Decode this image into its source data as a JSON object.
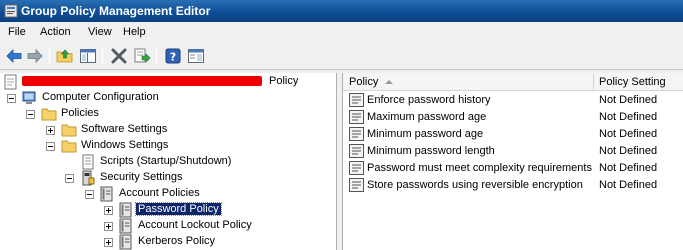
{
  "window": {
    "title": "Group Policy Management Editor"
  },
  "menu": [
    "File",
    "Action",
    "View",
    "Help"
  ],
  "toolbar": [
    "back-icon",
    "forward-icon",
    "up-folder-icon",
    "show-hide-tree-icon",
    "delete-icon",
    "export-list-icon",
    "help-icon",
    "properties-icon"
  ],
  "tree": {
    "root_suffix": "Policy",
    "computer_configuration": "Computer Configuration",
    "policies": "Policies",
    "software_settings": "Software Settings",
    "windows_settings": "Windows Settings",
    "scripts": "Scripts (Startup/Shutdown)",
    "security_settings": "Security Settings",
    "account_policies": "Account Policies",
    "password_policy": "Password Policy",
    "account_lockout_policy": "Account Lockout Policy",
    "kerberos_policy": "Kerberos Policy"
  },
  "list": {
    "col_policy": "Policy",
    "col_setting": "Policy Setting",
    "rows": [
      {
        "policy": "Enforce password history",
        "setting": "Not Defined"
      },
      {
        "policy": "Maximum password age",
        "setting": "Not Defined"
      },
      {
        "policy": "Minimum password age",
        "setting": "Not Defined"
      },
      {
        "policy": "Minimum password length",
        "setting": "Not Defined"
      },
      {
        "policy": "Password must meet complexity requirements",
        "setting": "Not Defined"
      },
      {
        "policy": "Store passwords using reversible encryption",
        "setting": "Not Defined"
      }
    ]
  },
  "colors": {
    "title_bar": "#0f4f97",
    "selection": "#0b246a",
    "redaction": "#ee0000"
  }
}
